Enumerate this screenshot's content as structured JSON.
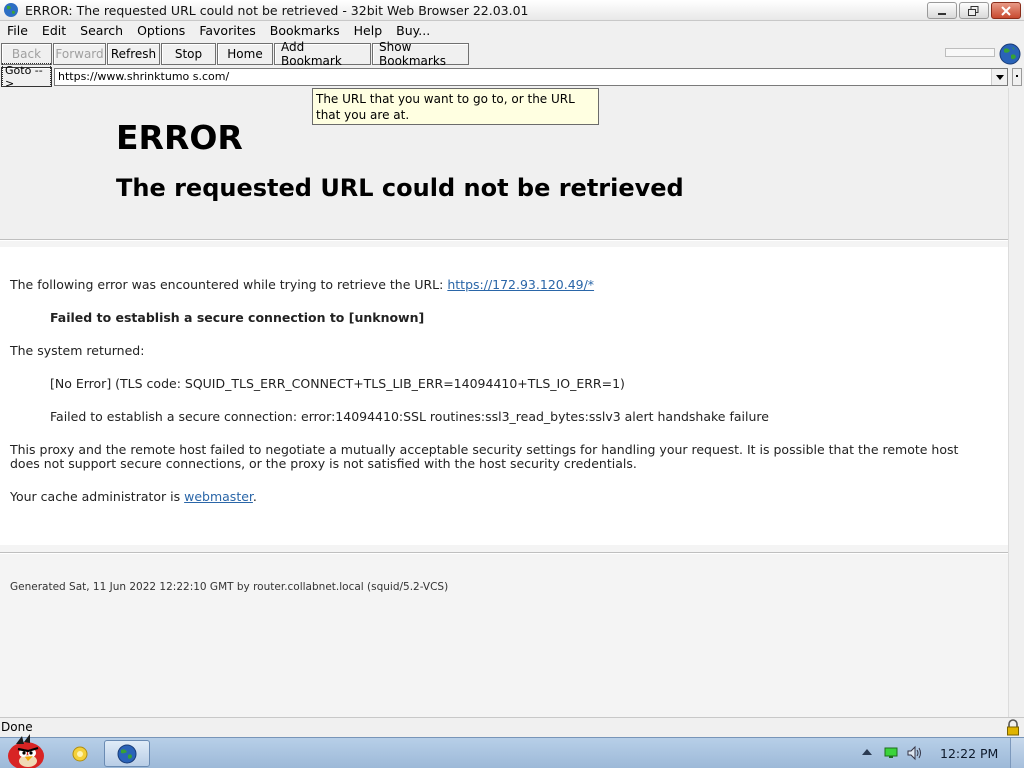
{
  "window": {
    "title": "ERROR: The requested URL could not be retrieved - 32bit Web Browser 22.03.01"
  },
  "menu": [
    "File",
    "Edit",
    "Search",
    "Options",
    "Favorites",
    "Bookmarks",
    "Help",
    "Buy..."
  ],
  "toolbar": {
    "back": "Back",
    "forward": "Forward",
    "refresh": "Refresh",
    "stop": "Stop",
    "home": "Home",
    "add_bookmark": "Add Bookmark",
    "show_bookmarks": "Show Bookmarks"
  },
  "address": {
    "goto_label": "Goto -->",
    "url": "https://www.shrinktumo s.com/"
  },
  "tooltip": "The URL that you want to go to, or the URL that you are at.",
  "page": {
    "heading": "ERROR",
    "subheading": "The requested URL could not be retrieved",
    "line1_prefix": "The following error was encountered while trying to retrieve the URL: ",
    "line1_link": "https://172.93.120.49/*",
    "failed_msg": "Failed to establish a secure connection to [unknown]",
    "system_returned": "The system returned:",
    "tls_code": "[No Error] (TLS code: SQUID_TLS_ERR_CONNECT+TLS_LIB_ERR=14094410+TLS_IO_ERR=1)",
    "ssl_error": "Failed to establish a secure connection: error:14094410:SSL routines:ssl3_read_bytes:sslv3 alert handshake failure",
    "explanation_1": "This proxy and the remote host failed to negotiate a mutually acceptable security settings for handling your request. It is possible that the remote host",
    "explanation_2": "does not support secure connections, or the proxy is not satisfied with the host security credentials.",
    "admin_prefix": "Your cache administrator is ",
    "admin_link": "webmaster",
    "admin_suffix": ".",
    "footer": "Generated Sat, 11 Jun 2022 12:22:10 GMT by router.collabnet.local (squid/5.2-VCS)"
  },
  "status": {
    "text": "Done"
  },
  "taskbar": {
    "clock": "12:22 PM"
  }
}
